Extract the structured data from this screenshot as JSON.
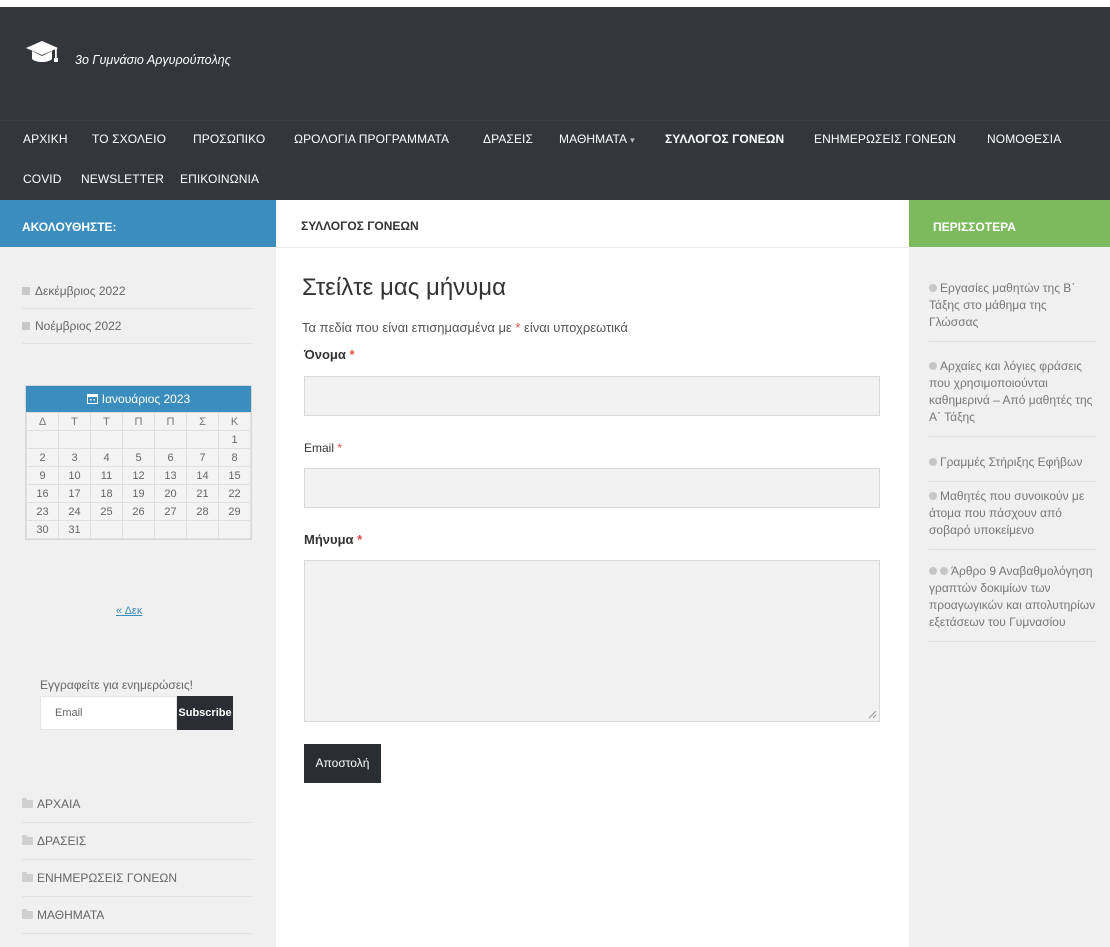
{
  "site": {
    "title": "3ο Γυμνάσιο Αργυρούπολης"
  },
  "nav": {
    "items": [
      "ΑΡΧΙΚΗ",
      "ΤΟ ΣΧΟΛΕΙΟ",
      "ΠΡΟΣΩΠΙΚΟ",
      "ΩΡΟΛΟΓΙΑ ΠΡΟΓΡΑΜΜΑΤΑ",
      "ΔΡΑΣΕΙΣ",
      "ΜΑΘΗΜΑΤΑ",
      "ΣΥΛΛΟΓΟΣ ΓΟΝΕΩΝ",
      "ΕΝΗΜΕΡΩΣΕΙΣ ΓΟΝΕΩΝ",
      "ΝΟΜΟΘΕΣΙΑ",
      "COVID",
      "NEWSLETTER",
      "ΕΠΙΚΟΙΝΩΝΙΑ"
    ],
    "active": "ΣΥΛΛΟΓΟΣ ΓΟΝΕΩΝ",
    "dropdown_caret": "▾"
  },
  "left": {
    "header": "ΑΚΟΛΟΥΘΗΣΤΕ:",
    "archives": [
      "Δεκέμβριος 2022",
      "Νοέμβριος 2022"
    ],
    "calendar": {
      "caption": "Ιανουάριος 2023",
      "weekdays": [
        "Δ",
        "Τ",
        "Τ",
        "Π",
        "Π",
        "Σ",
        "Κ"
      ],
      "weeks": [
        [
          "",
          "",
          "",
          "",
          "",
          "",
          "1"
        ],
        [
          "2",
          "3",
          "4",
          "5",
          "6",
          "7",
          "8"
        ],
        [
          "9",
          "10",
          "11",
          "12",
          "13",
          "14",
          "15"
        ],
        [
          "16",
          "17",
          "18",
          "19",
          "20",
          "21",
          "22"
        ],
        [
          "23",
          "24",
          "25",
          "26",
          "27",
          "28",
          "29"
        ],
        [
          "30",
          "31",
          "",
          "",
          "",
          "",
          ""
        ]
      ],
      "prev": "« Δεκ"
    },
    "subscribe": {
      "label": "Εγγραφείτε για ενημερώσεις!",
      "placeholder": "Email",
      "button": "Subscribe"
    },
    "categories": [
      "ΑΡΧΑΙΑ",
      "ΔΡΑΣΕΙΣ",
      "ΕΝΗΜΕΡΩΣΕΙΣ ΓΟΝΕΩΝ",
      "ΜΑΘΗΜΑΤΑ"
    ]
  },
  "main": {
    "header": "ΣΥΛΛΟΓΟΣ ΓΟΝΕΩΝ",
    "form": {
      "title": "Στείλτε μας μήνυμα",
      "note_before": "Τα πεδία που είναι επισημασμένα με",
      "note_star": "*",
      "note_after": "είναι υποχρεωτικά",
      "name_label": "Όνομα",
      "email_label": "Email",
      "message_label": "Μήνυμα",
      "required_star": "*",
      "submit": "Αποστολή"
    }
  },
  "right": {
    "header": "ΠΕΡΙΣΣΟΤΕΡΑ",
    "posts": [
      "Εργασίες μαθητών της Β΄ Τάξης στο μάθημα της Γλώσσας",
      "Αρχαίες και λόγιες φράσεις που χρησιμοποιούνται καθημερινά – Από μαθητές της Α΄ Τάξης",
      "Γραμμές Στήριξης Εφήβων",
      "Μαθητές που συνοικούν με άτομα που πάσχουν από σοβαρό υποκείμενο",
      "Άρθρο 9 Αναβαθμολόγηση γραπτών δοκιμίων των προαγωγικών και απολυτηρίων εξετάσεων του Γυμνασίου"
    ]
  },
  "colors": {
    "header_bg": "#33363b",
    "blue": "#3b8dbd",
    "green": "#7dba5e",
    "sidebar_bg": "#f0f0f0",
    "required": "#e24a4a"
  },
  "icons": [
    "graduation-cap-icon",
    "calendar-icon",
    "archive-square-icon",
    "folder-icon",
    "bullet-icon",
    "resize-grip-icon"
  ]
}
